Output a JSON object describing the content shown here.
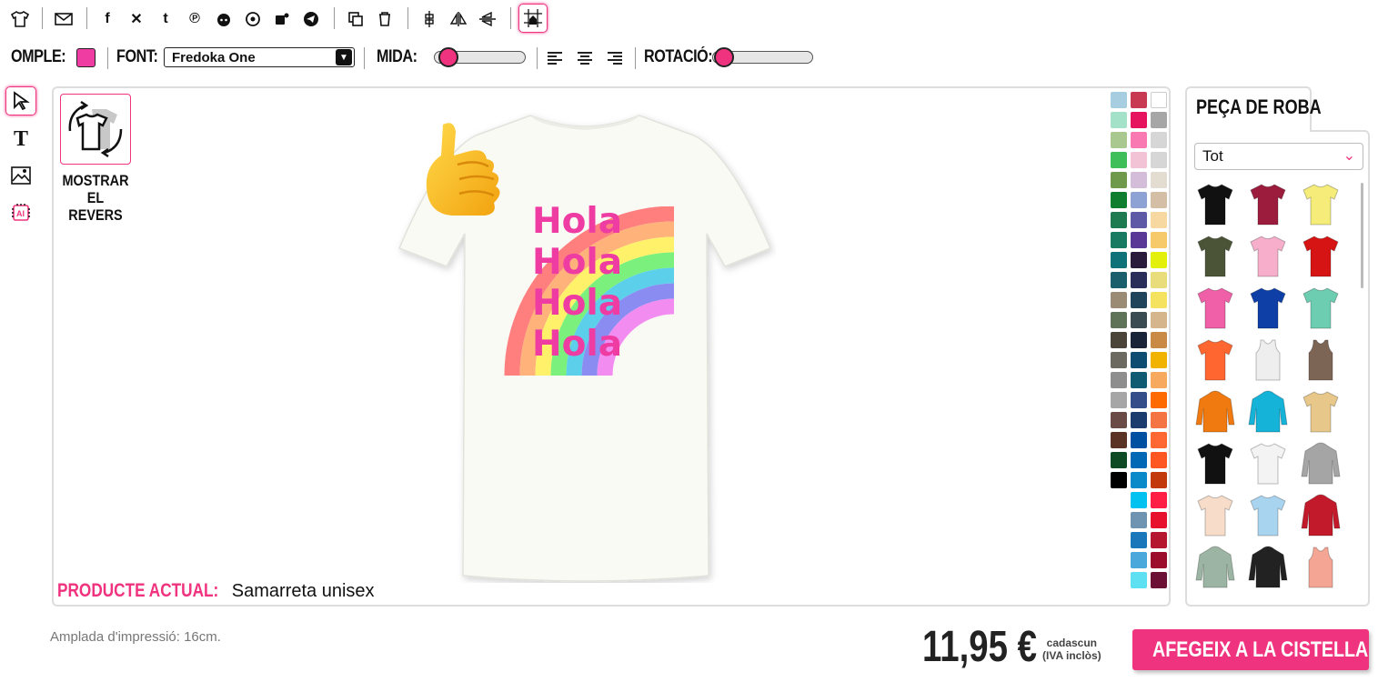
{
  "toolbar": {
    "fill_label": "OMPLE:",
    "font_label": "FONT:",
    "font_value": "Fredoka One",
    "size_label": "MIDA:",
    "rotation_label": "ROTACIÓ:",
    "fill_color": "#ee3ca3",
    "size_level": 0.1,
    "rotation_level": 0.1
  },
  "canvas": {
    "show_back_label": "MOSTRAR EL REVERS",
    "current_product_key": "PRODUCTE ACTUAL:",
    "current_product_value": "Samarreta unisex",
    "design_text": [
      "Hola",
      "Hola",
      "Hola",
      "Hola"
    ]
  },
  "palette": {
    "col1": [
      "#a7cde1",
      "#a3e2c9",
      "#a9c88f",
      "#3fbf5a",
      "#6f9a4b",
      "#0f7f2f",
      "#1e7a4f",
      "#177a61",
      "#0f7278",
      "#1a5f6b",
      "#9c8b74",
      "#5f7359",
      "#4b4438",
      "#6c6a60",
      "#8e8e8e",
      "#a6a6a6",
      "#6b4b45",
      "#5a3325",
      "#0e4a23",
      "#000000"
    ],
    "col2": [
      "#c83a52",
      "#e6135f",
      "#f97ab2",
      "#f1c3d4",
      "#d3bdd8",
      "#8da3d4",
      "#5f5aa6",
      "#5a3895",
      "#2a1a3c",
      "#2a2f5a",
      "#20445a",
      "#3a4b52",
      "#1a2438",
      "#0f4c71",
      "#0f5b72",
      "#354e8a",
      "#1d3c6e",
      "#0050a1",
      "#0068b4",
      "#0a8ac9",
      "#00c2f0",
      "#6f94b1",
      "#1a77b9",
      "#4ba8da",
      "#5ce0f2"
    ],
    "col3": [
      "#ffffff",
      "#a6a6a6",
      "#d6d6d6",
      "#d6d6d6",
      "#e3ddd1",
      "#d4bfa6",
      "#f6d8a0",
      "#f6c96a",
      "#e2f00a",
      "#e8dd7a",
      "#f5e35f",
      "#d4b58c",
      "#c88a45",
      "#f2b200",
      "#f7a95e",
      "#ff6a00",
      "#f47444",
      "#ff6733",
      "#ff5722",
      "#c23a0c",
      "#ff1f45",
      "#e8112d",
      "#b5172e",
      "#9c0d2b",
      "#6c1135"
    ]
  },
  "panel": {
    "tab_label": "PEÇA DE ROBA",
    "filter_value": "Tot",
    "products": [
      {
        "name": "tshirt-black",
        "color": "#111111"
      },
      {
        "name": "tshirt-burgundy",
        "color": "#9b1c3d"
      },
      {
        "name": "tshirt-yellow",
        "color": "#f5ec7a"
      },
      {
        "name": "tshirt-olive",
        "color": "#4b5436"
      },
      {
        "name": "tshirt-pink",
        "color": "#f6aecb"
      },
      {
        "name": "tshirt-red",
        "color": "#d71414"
      },
      {
        "name": "tshirt-hotpink",
        "color": "#f060a8"
      },
      {
        "name": "tshirt-royal",
        "color": "#0d3fa6"
      },
      {
        "name": "tshirt-mint",
        "color": "#6ccdb0"
      },
      {
        "name": "tshirt-orange",
        "color": "#ff6630"
      },
      {
        "name": "tank-white",
        "color": "#eeeeee"
      },
      {
        "name": "tank-brown",
        "color": "#7d6556"
      },
      {
        "name": "hoodie-orange",
        "color": "#f07a10"
      },
      {
        "name": "hoodie-cyan",
        "color": "#15b3d8"
      },
      {
        "name": "tshirt-tiedye",
        "color": "#e8c88a"
      },
      {
        "name": "tshirt-black2",
        "color": "#111111"
      },
      {
        "name": "raglan-white",
        "color": "#f3f3f3"
      },
      {
        "name": "hoodie-grey",
        "color": "#a5a5a5"
      },
      {
        "name": "tshirt-peach",
        "color": "#f6dcc9"
      },
      {
        "name": "tshirt-gradient",
        "color": "#a8d4ef"
      },
      {
        "name": "jacket-red",
        "color": "#c21a2a"
      },
      {
        "name": "sweat-green",
        "color": "#9bb4a3"
      },
      {
        "name": "hoodie-black-orange",
        "color": "#222222"
      },
      {
        "name": "tank-coral",
        "color": "#f4a594"
      }
    ]
  },
  "footer": {
    "print_width": "Amplada d'impressió: 16cm.",
    "price": "11,95 €",
    "each_line1": "cadascun",
    "each_line2": "(IVA inclòs)",
    "add_to_cart": "AFEGEIX A LA CISTELLA"
  }
}
